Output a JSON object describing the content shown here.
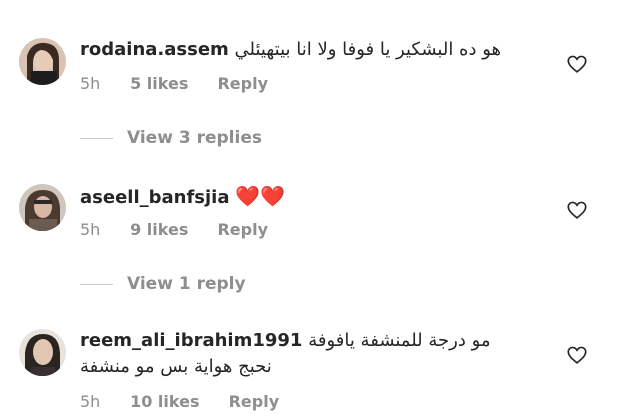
{
  "comments": [
    {
      "username": "rodaina.assem",
      "text": "هو ده البشكير يا فوفا ولا انا بيتهيئلي",
      "time": "5h",
      "likes": "5 likes",
      "reply": "Reply",
      "view_replies": "View 3 replies"
    },
    {
      "username": "aseell_banfsjia",
      "text": "❤️❤️",
      "time": "5h",
      "likes": "9 likes",
      "reply": "Reply",
      "view_replies": "View 1 reply"
    },
    {
      "username": "reem_ali_ibrahim1991",
      "text": "مو درجة للمنشفة يافوفة",
      "text_line2": "نحبج هواية بس مو منشفة",
      "time": "5h",
      "likes": "10 likes",
      "reply": "Reply"
    }
  ],
  "icons": {
    "like": "heart-outline-icon"
  },
  "colors": {
    "text": "#262626",
    "muted": "#8e8e8e",
    "heart_emoji": "#e0242d"
  }
}
